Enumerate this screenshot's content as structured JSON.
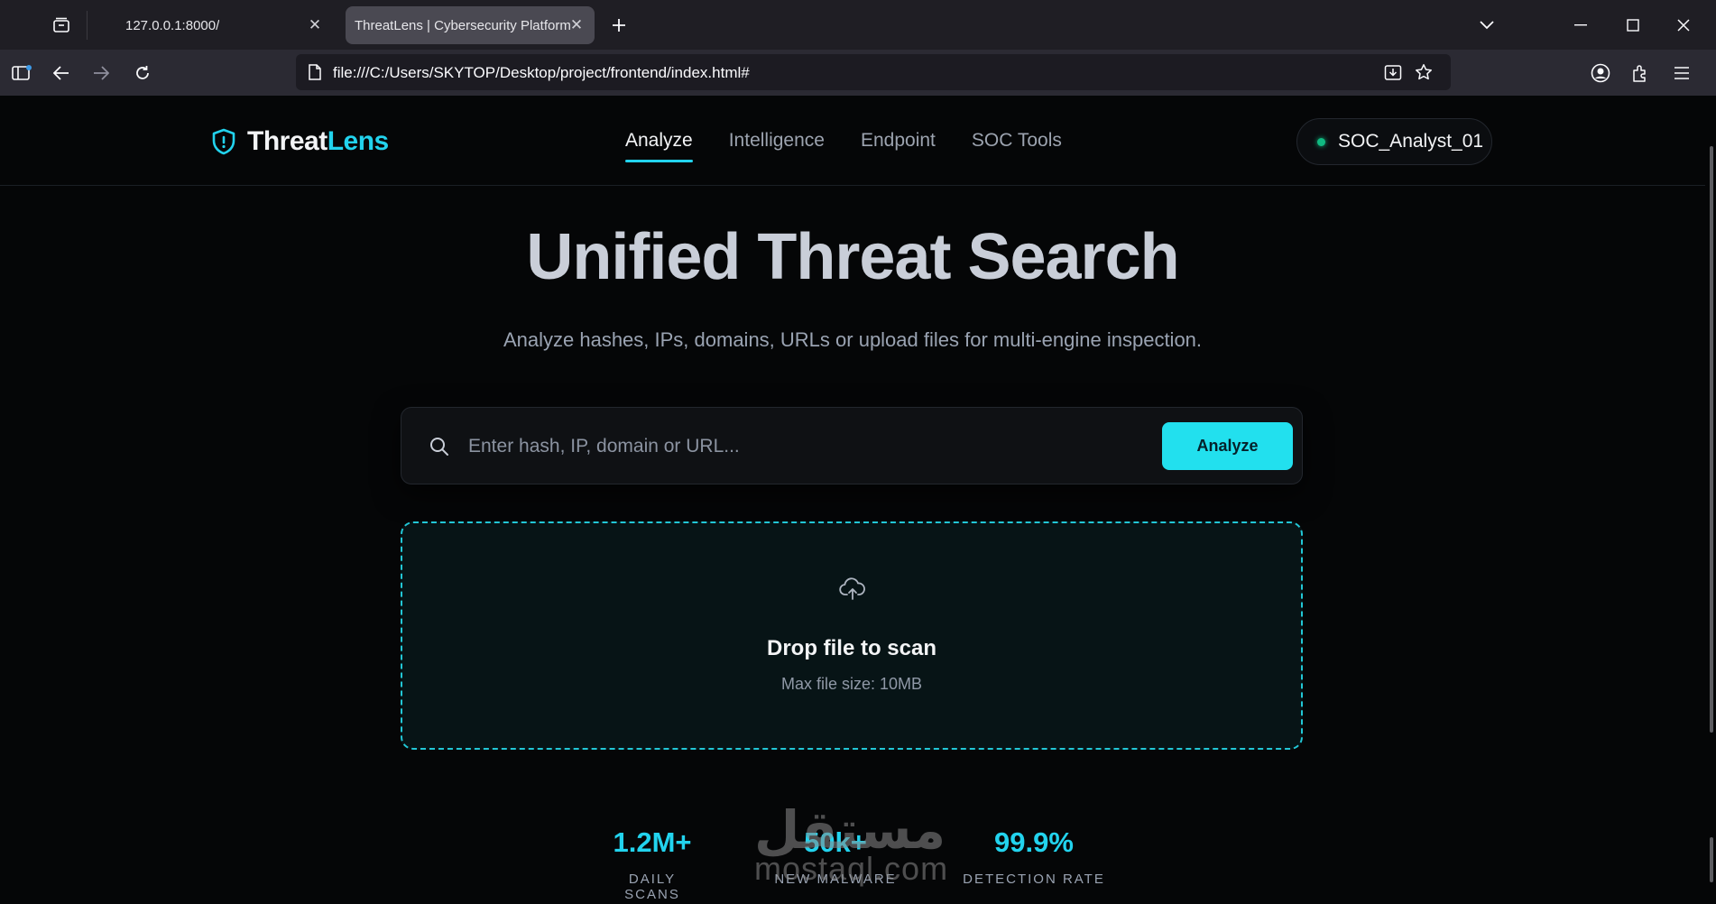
{
  "browser": {
    "tabs": [
      {
        "title": "127.0.0.1:8000/",
        "active": false
      },
      {
        "title": "ThreatLens | Cybersecurity Platform",
        "active": true
      }
    ],
    "url": "file:///C:/Users/SKYTOP/Desktop/project/frontend/index.html#",
    "icons": [
      "tab-list-icon",
      "close-icon",
      "plus-icon",
      "chevron-down-icon",
      "minimize-icon",
      "maximize-icon",
      "window-close-icon",
      "sidebar-icon",
      "back-arrow-icon",
      "forward-arrow-icon",
      "reload-icon",
      "page-icon",
      "save-to-pocket-icon",
      "star-icon",
      "account-icon",
      "extensions-icon",
      "menu-icon"
    ]
  },
  "header": {
    "logo_primary": "Threat",
    "logo_accent": "Lens",
    "nav": [
      {
        "label": "Analyze",
        "active": true
      },
      {
        "label": "Intelligence",
        "active": false
      },
      {
        "label": "Endpoint",
        "active": false
      },
      {
        "label": "SOC Tools",
        "active": false
      }
    ],
    "user": "SOC_Analyst_01"
  },
  "hero": {
    "title": "Unified Threat Search",
    "subtitle": "Analyze hashes, IPs, domains, URLs or upload files for multi-engine inspection."
  },
  "search": {
    "placeholder": "Enter hash, IP, domain or URL...",
    "value": "",
    "button": "Analyze"
  },
  "dropzone": {
    "title": "Drop file to scan",
    "subtitle": "Max file size: 10MB"
  },
  "stats": [
    {
      "value": "1.2M+",
      "label": "DAILY SCANS"
    },
    {
      "value": "50k+",
      "label": "NEW MALWARE"
    },
    {
      "value": "99.9%",
      "label": "DETECTION RATE"
    }
  ],
  "watermark": {
    "arabic": "مستقل",
    "latin": "mostaql.com"
  },
  "colors": {
    "accent": "#22d3ee",
    "button": "#22e0ee",
    "status_online": "#10b981",
    "page_background": "#050607"
  }
}
